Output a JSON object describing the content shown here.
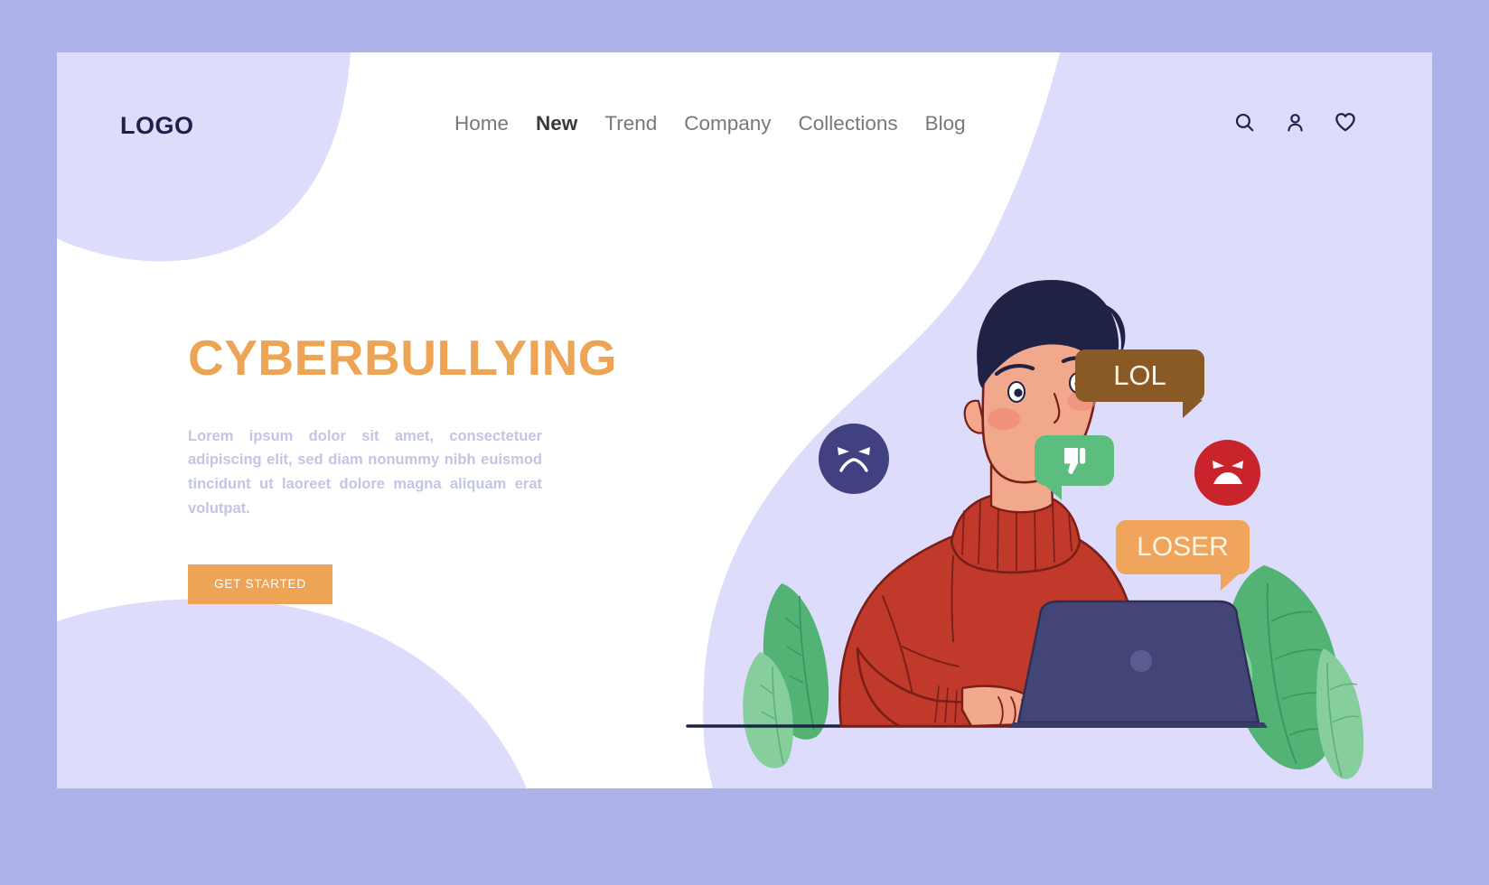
{
  "page": {
    "outer_background": "#AEB2EA",
    "panel_background": "#DDDDFB",
    "accent_color": "#EDA455"
  },
  "header": {
    "logo": "LOGO",
    "nav": [
      {
        "label": "Home",
        "active": false
      },
      {
        "label": "New",
        "active": true
      },
      {
        "label": "Trend",
        "active": false
      },
      {
        "label": "Company",
        "active": false
      },
      {
        "label": "Collections",
        "active": false
      },
      {
        "label": "Blog",
        "active": false
      }
    ],
    "icons": [
      {
        "name": "search-icon",
        "label": "Search"
      },
      {
        "name": "user-icon",
        "label": "Account"
      },
      {
        "name": "heart-icon",
        "label": "Favorites"
      }
    ]
  },
  "hero": {
    "title": "CYBERBULLYING",
    "paragraph": "Lorem ipsum dolor sit amet, consectetuer adipiscing elit, sed diam nonummy nibh euismod tincidunt ut laoreet dolore magna aliquam erat volutpat.",
    "cta_label": "GET STARTED",
    "title_color": "#EDA455",
    "paragraph_color": "#C3C5E4"
  },
  "illustration": {
    "alt": "Worried man at laptop receiving abusive messages",
    "bubbles": [
      {
        "name": "bubble-lol",
        "text": "LOL",
        "color": "#8A5A26",
        "text_color": "#FBF5E4"
      },
      {
        "name": "bubble-loser",
        "text": "LOSER",
        "color": "#F0A45C",
        "text_color": "#FBF5E4"
      },
      {
        "name": "bubble-dislike",
        "text": "",
        "color": "#5BBD7E",
        "icon": "thumbs-down-icon"
      }
    ],
    "badges": [
      {
        "name": "angry-face-blue-badge",
        "color": "#414182",
        "icon": "angry-face-icon"
      },
      {
        "name": "angry-face-red-badge",
        "color": "#C9232C",
        "icon": "angry-face-icon"
      }
    ],
    "colors": {
      "sweater": "#C0392B",
      "skin": "#F2A88C",
      "hair": "#1F2244",
      "laptop": "#434577",
      "leaf_dark": "#52B375",
      "leaf_light": "#86CF9C",
      "desk_line": "#1F2244"
    }
  }
}
